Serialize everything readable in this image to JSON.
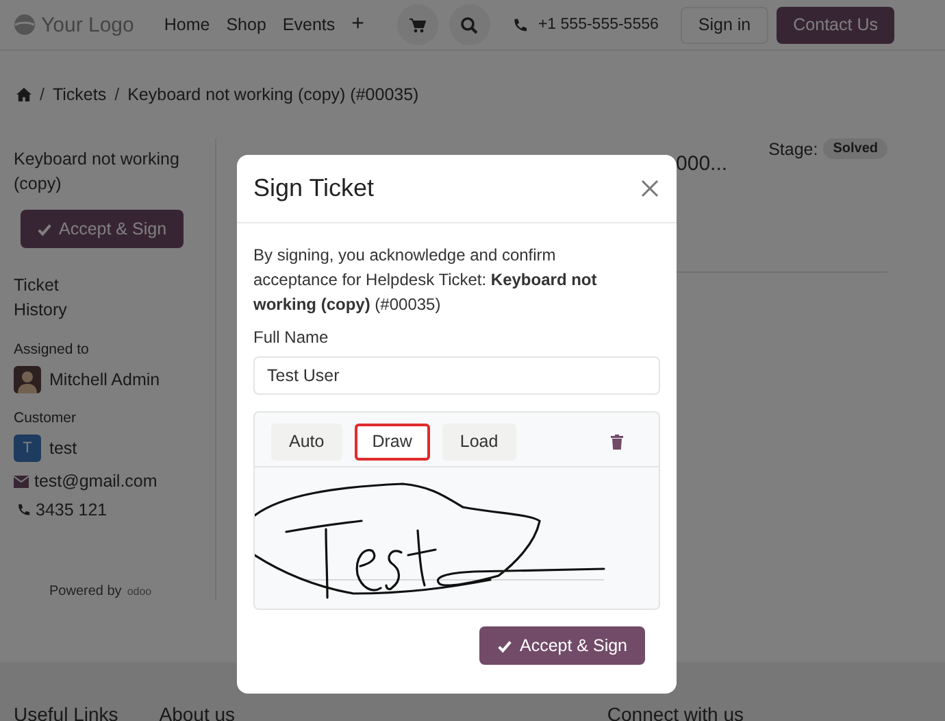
{
  "navbar": {
    "logo": "Your Logo",
    "links": [
      {
        "label": "Home"
      },
      {
        "label": "Shop"
      },
      {
        "label": "Events"
      },
      {
        "label": "+"
      }
    ],
    "phone": "+1 555-555-5556",
    "sign_in": "Sign in",
    "contact": "Contact Us"
  },
  "breadcrumb": [
    {
      "separator": "/",
      "label": "Tickets"
    },
    {
      "separator": "/",
      "label": "Keyboard not working (copy) (#00035)"
    }
  ],
  "sidebar": {
    "title": "Keyboard not working (copy)",
    "accept_button": "Accept & Sign",
    "links": [
      "Ticket",
      "History"
    ],
    "assigned_label": "Assigned to",
    "assignee": "Mitchell Admin",
    "customer_label": "Customer",
    "customer": {
      "initial": "T",
      "name": "test",
      "email": "test@gmail.com",
      "phone": "3435 121"
    },
    "powered_by": "Powered by",
    "powered_brand": "odoo"
  },
  "ticket": {
    "title_fragment": "000...",
    "stage_label": "Stage:",
    "stage": "Solved"
  },
  "footer": {
    "headings": [
      "Useful Links",
      "About us",
      "Connect with us"
    ]
  },
  "dialog": {
    "title": "Sign Ticket",
    "message": "By signing, you acknowledge and confirm acceptance for Helpdesk Ticket: **Keyboard not working (copy)** (#00035)",
    "name_label": "Full Name",
    "name_value": "Test User",
    "modes": [
      {
        "label": "Auto",
        "selected": false
      },
      {
        "label": "Draw",
        "selected": true
      },
      {
        "label": "Load",
        "selected": false
      }
    ],
    "submit": "Accept & Sign"
  }
}
